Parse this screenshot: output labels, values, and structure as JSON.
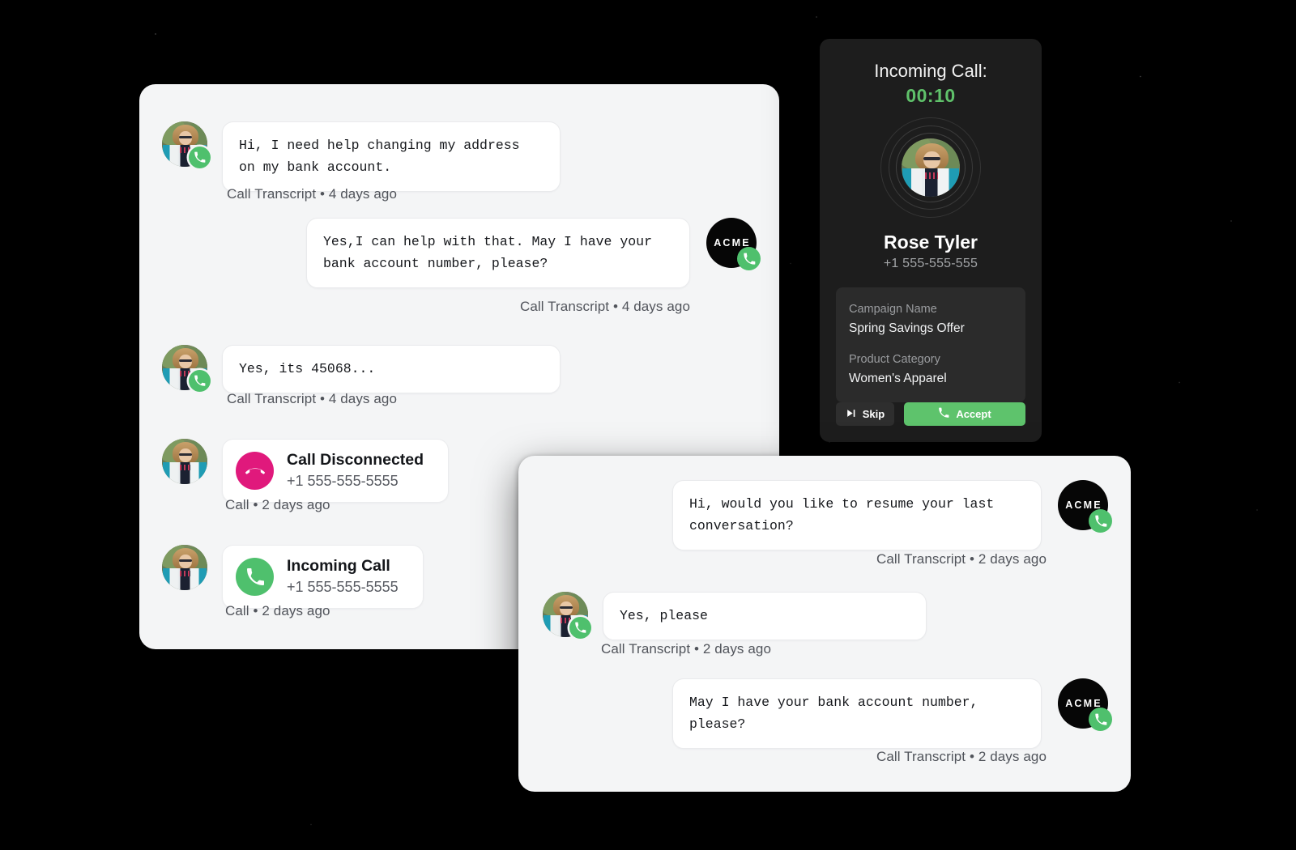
{
  "background": {
    "color": "#000000"
  },
  "accents": {
    "green": "#4fc06d",
    "accept_green": "#5ec36c",
    "timer_green": "#5fc16a",
    "disconnect_pink": "#e0197c",
    "card_bg": "#f4f5f6",
    "bubble_bg": "#ffffff",
    "panel_bg": "#1d1d1d",
    "info_bg": "#2b2b2b"
  },
  "brand": {
    "avatar_wordmark": "ACME"
  },
  "main_card": {
    "messages": [
      {
        "side": "left",
        "avatar": "customer-photo",
        "text": "Hi, I need help changing my address\non my bank account.",
        "meta": "Call Transcript • 4 days ago"
      },
      {
        "side": "right",
        "avatar": "acme-logo",
        "text": "Yes,I can help with that. May I have your\nbank account number, please?",
        "meta": "Call Transcript • 4 days ago"
      },
      {
        "side": "left",
        "avatar": "customer-photo",
        "text": "Yes, its 45068...",
        "meta": "Call Transcript • 4 days ago"
      }
    ],
    "events": [
      {
        "icon": "phone-hangup-icon",
        "status": "disconnected",
        "title": "Call Disconnected",
        "phone": "+1 555-555-5555",
        "meta": "Call • 2 days ago"
      },
      {
        "icon": "phone-incoming-icon",
        "status": "incoming",
        "title": "Incoming Call",
        "phone": "+1 555-555-5555",
        "meta": "Call • 2 days ago"
      }
    ]
  },
  "second_card": {
    "messages": [
      {
        "side": "right",
        "avatar": "acme-logo",
        "text": "Hi, would you like to resume your last\nconversation?",
        "meta": "Call Transcript • 2 days ago"
      },
      {
        "side": "left",
        "avatar": "customer-photo",
        "text": "Yes, please",
        "meta": "Call Transcript • 2 days ago"
      },
      {
        "side": "right",
        "avatar": "acme-logo",
        "text": "May I have your bank account number,\nplease?",
        "meta": "Call Transcript • 2 days ago"
      }
    ]
  },
  "call_panel": {
    "title": "Incoming Call:",
    "timer": "00:10",
    "caller_name": "Rose Tyler",
    "caller_phone": "+1 555-555-555",
    "info": [
      {
        "label": "Campaign Name",
        "value": "Spring Savings Offer"
      },
      {
        "label": "Product Category",
        "value": "Women's Apparel"
      }
    ],
    "actions": {
      "skip_label": "Skip",
      "accept_label": "Accept"
    }
  }
}
